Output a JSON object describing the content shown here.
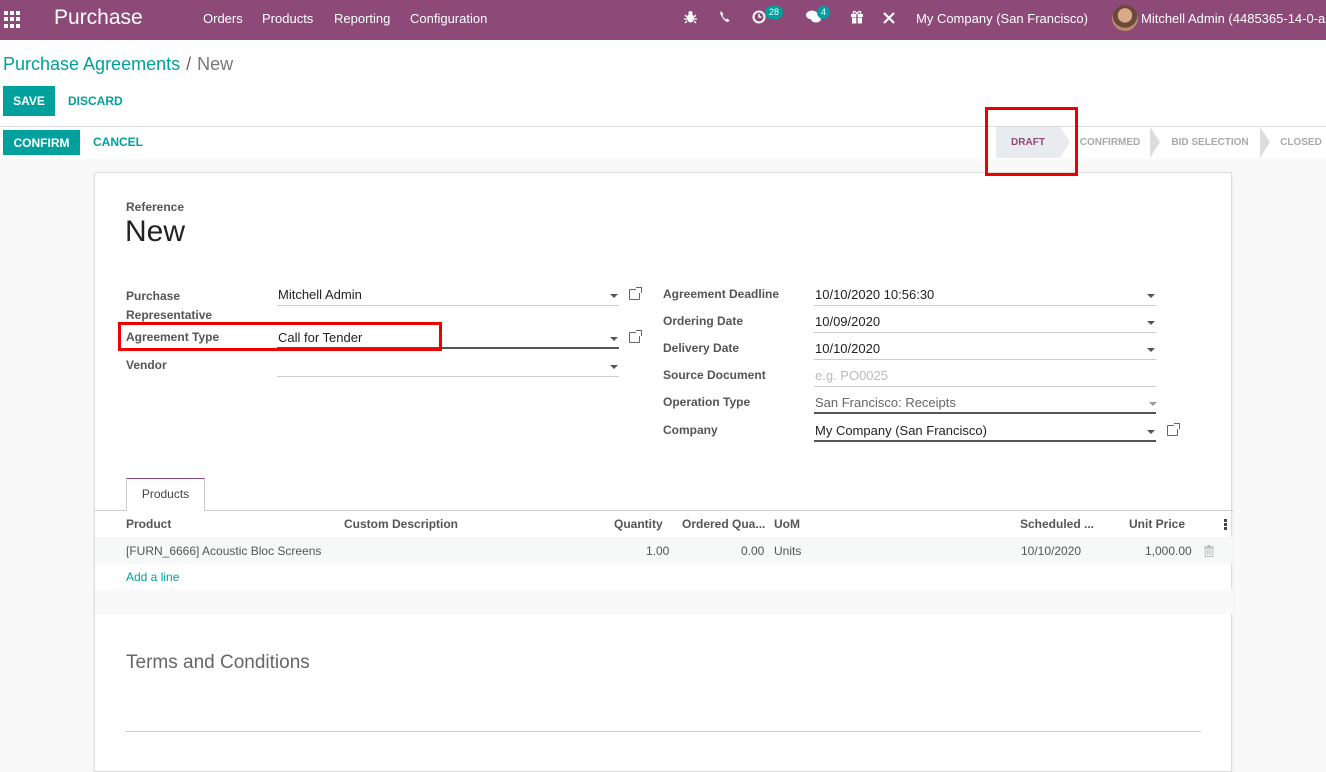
{
  "navbar": {
    "app_name": "Purchase",
    "menu": [
      "Orders",
      "Products",
      "Reporting",
      "Configuration"
    ],
    "icons": [
      "bug-icon",
      "phone-icon",
      "activity-clock-icon",
      "chat-icon",
      "gift-icon",
      "tools-icon"
    ],
    "activity_count": "28",
    "message_count": "4",
    "company": "My Company (San Francisco)",
    "user": "Mitchell Admin (4485365-14-0-a"
  },
  "breadcrumb": {
    "parent": "Purchase Agreements",
    "separator": "/",
    "current": "New"
  },
  "actions": {
    "save": "SAVE",
    "discard": "DISCARD",
    "confirm": "CONFIRM",
    "cancel": "CANCEL"
  },
  "status": {
    "stages": [
      "DRAFT",
      "CONFIRMED",
      "BID SELECTION",
      "CLOSED"
    ],
    "active": "DRAFT"
  },
  "form": {
    "reference_label": "Reference",
    "reference_value": "New",
    "left": [
      {
        "label": "Purchase Representative",
        "value": "Mitchell Admin"
      },
      {
        "label": "Agreement Type",
        "value": "Call for Tender"
      },
      {
        "label": "Vendor",
        "value": ""
      }
    ],
    "right": [
      {
        "label": "Agreement Deadline",
        "value": "10/10/2020 10:56:30"
      },
      {
        "label": "Ordering Date",
        "value": "10/09/2020"
      },
      {
        "label": "Delivery Date",
        "value": "10/10/2020"
      },
      {
        "label": "Source Document",
        "value": "",
        "placeholder": "e.g. PO0025"
      },
      {
        "label": "Operation Type",
        "value": "San Francisco: Receipts"
      },
      {
        "label": "Company",
        "value": "My Company (San Francisco)"
      }
    ]
  },
  "tabs": [
    "Products"
  ],
  "table": {
    "headers": [
      "Product",
      "Custom Description",
      "Quantity",
      "Ordered Qua...",
      "UoM",
      "Scheduled ...",
      "Unit Price"
    ],
    "rows": [
      {
        "product": "[FURN_6666] Acoustic Bloc Screens",
        "description": "",
        "quantity": "1.00",
        "ordered": "0.00",
        "uom": "Units",
        "scheduled": "10/10/2020",
        "unit_price": "1,000.00"
      }
    ],
    "add_line": "Add a line"
  },
  "terms_title": "Terms and Conditions",
  "colors": {
    "brand": "#8d4a78",
    "accent": "#00a09d",
    "highlight": "#e00000"
  }
}
